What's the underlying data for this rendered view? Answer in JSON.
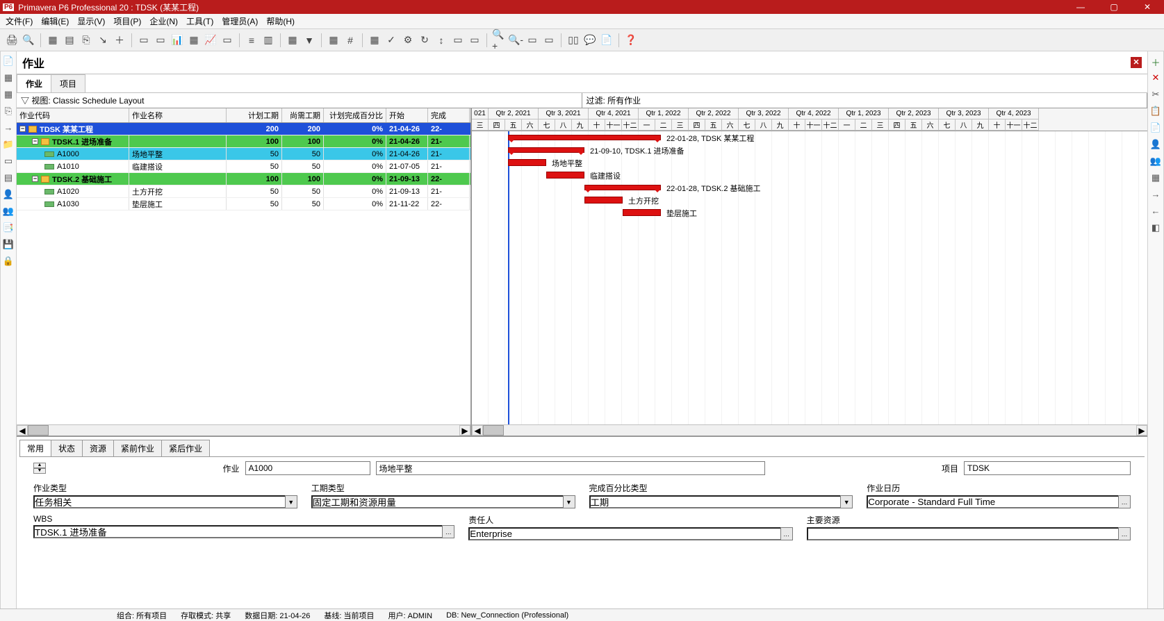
{
  "title": "Primavera P6 Professional 20 : TDSK (某某工程)",
  "menu": [
    "文件(F)",
    "编辑(E)",
    "显示(V)",
    "项目(P)",
    "企业(N)",
    "工具(T)",
    "管理员(A)",
    "帮助(H)"
  ],
  "panel_title": "作业",
  "tabs": [
    "作业",
    "项目"
  ],
  "view_label": "视图: Classic Schedule Layout",
  "filter_label": "过滤: 所有作业",
  "columns": {
    "code": "作业代码",
    "name": "作业名称",
    "planned": "计划工期",
    "remain": "尚需工期",
    "pct": "计划完成百分比",
    "start": "开始",
    "finish": "完成"
  },
  "rows": [
    {
      "type": "proj",
      "indent": 0,
      "code": "TDSK 某某工程",
      "name": "",
      "pd": "200",
      "rd": "200",
      "pc": "0%",
      "st": "21-04-26",
      "fn": "22-"
    },
    {
      "type": "wbs",
      "indent": 1,
      "code": "TDSK.1 进场准备",
      "name": "",
      "pd": "100",
      "rd": "100",
      "pc": "0%",
      "st": "21-04-26",
      "fn": "21-"
    },
    {
      "type": "act",
      "indent": 2,
      "sel": true,
      "code": "A1000",
      "name": "场地平整",
      "pd": "50",
      "rd": "50",
      "pc": "0%",
      "st": "21-04-26",
      "fn": "21-"
    },
    {
      "type": "act",
      "indent": 2,
      "code": "A1010",
      "name": "临建搭设",
      "pd": "50",
      "rd": "50",
      "pc": "0%",
      "st": "21-07-05",
      "fn": "21-"
    },
    {
      "type": "wbs",
      "indent": 1,
      "code": "TDSK.2 基础施工",
      "name": "",
      "pd": "100",
      "rd": "100",
      "pc": "0%",
      "st": "21-09-13",
      "fn": "22-"
    },
    {
      "type": "act",
      "indent": 2,
      "code": "A1020",
      "name": "土方开挖",
      "pd": "50",
      "rd": "50",
      "pc": "0%",
      "st": "21-09-13",
      "fn": "21-"
    },
    {
      "type": "act",
      "indent": 2,
      "code": "A1030",
      "name": "垫层施工",
      "pd": "50",
      "rd": "50",
      "pc": "0%",
      "st": "21-11-22",
      "fn": "22-"
    }
  ],
  "quarters": [
    "021",
    "Qtr 2, 2021",
    "Qtr 3, 2021",
    "Qtr 4, 2021",
    "Qtr 1, 2022",
    "Qtr 2, 2022",
    "Qtr 3, 2022",
    "Qtr 4, 2022",
    "Qtr 1, 2023",
    "Qtr 2, 2023",
    "Qtr 3, 2023",
    "Qtr 4, 2023"
  ],
  "months": [
    "三",
    "四",
    "五",
    "六",
    "七",
    "八",
    "九",
    "十",
    "十一",
    "十二",
    "一",
    "二",
    "三",
    "四",
    "五",
    "六",
    "七",
    "八",
    "九",
    "十",
    "十一",
    "十二",
    "一",
    "二",
    "三",
    "四",
    "五",
    "六",
    "七",
    "八",
    "九",
    "十",
    "十一",
    "十二"
  ],
  "ganttLabels": [
    "22-01-28, TDSK 某某工程",
    "21-09-10, TDSK.1 进场准备",
    "场地平整",
    "临建搭设",
    "22-01-28, TDSK.2 基础施工",
    "土方开挖",
    "垫层施工"
  ],
  "bottomTabs": [
    "常用",
    "状态",
    "资源",
    "紧前作业",
    "紧后作业"
  ],
  "form": {
    "activity_lbl": "作业",
    "activity_id": "A1000",
    "activity_name": "场地平整",
    "project_lbl": "项目",
    "project_val": "TDSK",
    "type_lbl": "作业类型",
    "type_val": "任务相关",
    "dur_lbl": "工期类型",
    "dur_val": "固定工期和资源用量",
    "pct_lbl": "完成百分比类型",
    "pct_val": "工期",
    "cal_lbl": "作业日历",
    "cal_val": "Corporate - Standard Full Time",
    "wbs_lbl": "WBS",
    "wbs_val": "TDSK.1 进场准备",
    "owner_lbl": "责任人",
    "owner_val": "Enterprise",
    "res_lbl": "主要资源",
    "res_val": ""
  },
  "status": {
    "group": "组合: 所有项目",
    "access": "存取模式: 共享",
    "date": "数据日期: 21-04-26",
    "baseline": "基线: 当前项目",
    "user": "用户: ADMIN",
    "db": "DB: New_Connection (Professional)"
  }
}
